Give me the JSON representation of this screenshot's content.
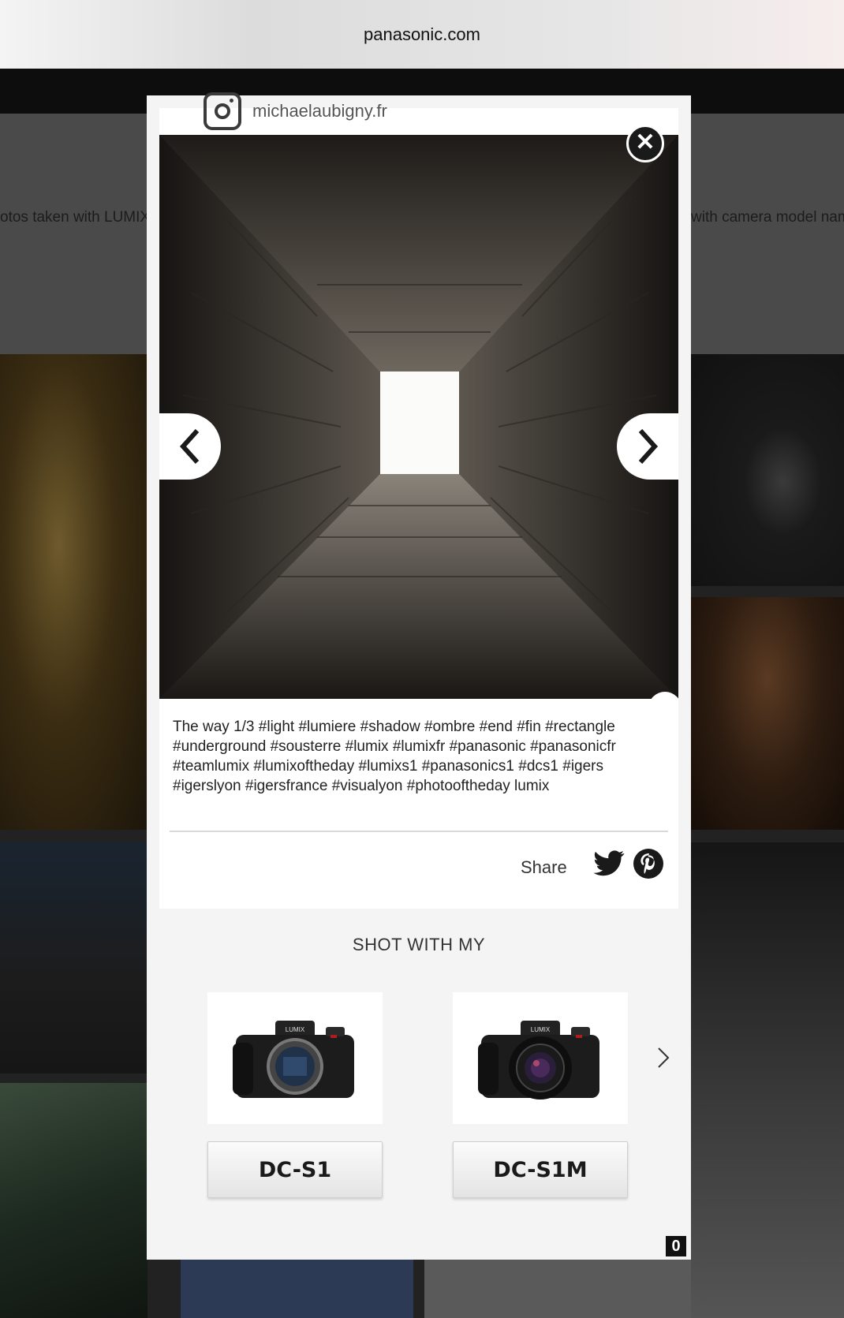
{
  "browser": {
    "url": "panasonic.com"
  },
  "background": {
    "intro_left": "otos taken with LUMIX",
    "intro_right": "with camera model nam"
  },
  "modal": {
    "username": "michaelaubigny.fr",
    "close_label": "✕",
    "report_label": "!",
    "caption": "The way 1/3 #light #lumiere #shadow #ombre #end #fin #rectangle #underground #sousterre #lumix #lumixfr #panasonic #panasonicfr #teamlumix #lumixoftheday #lumixs1 #panasonics1 #dcs1 #igers #igerslyon #igersfrance #visualyon #photooftheday lumix",
    "share_label": "Share",
    "shot_with_title": "SHOT WITH MY",
    "products": [
      {
        "name": "DC-S1",
        "image": "camera-body-icon"
      },
      {
        "name": "DC-S1M",
        "image": "camera-with-lens-icon"
      }
    ],
    "badge": "0"
  }
}
